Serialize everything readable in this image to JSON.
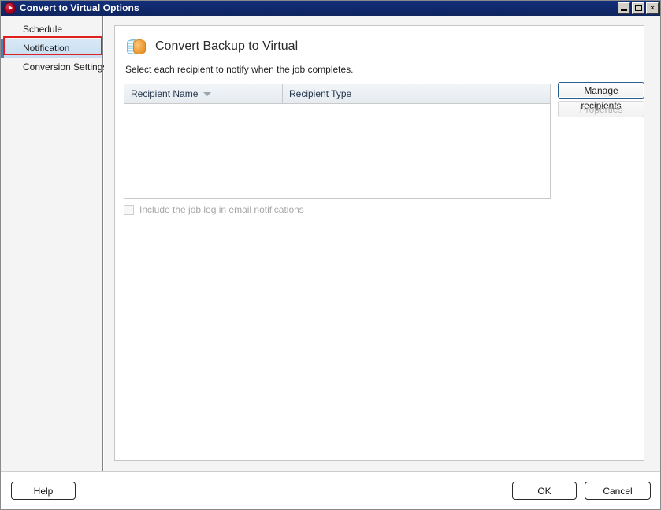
{
  "window": {
    "title": "Convert to Virtual Options",
    "app_icon": "record-circle-icon",
    "controls": {
      "minimize": "minimize-icon",
      "maximize": "maximize-icon",
      "close": "✕"
    }
  },
  "sidebar": {
    "items": [
      {
        "label": "Schedule",
        "selected": false
      },
      {
        "label": "Notification",
        "selected": true
      },
      {
        "label": "Conversion Settings",
        "selected": false
      }
    ]
  },
  "main": {
    "icon": "database-convert-icon",
    "title": "Convert Backup to Virtual",
    "subtitle": "Select each recipient to notify when the job completes.",
    "grid": {
      "columns": [
        "Recipient Name",
        "Recipient Type",
        ""
      ],
      "sort_column": "Recipient Name",
      "sort_direction": "descending",
      "rows": []
    },
    "checkbox": {
      "label": "Include the job log in email notifications",
      "checked": false,
      "enabled": false
    },
    "actions": {
      "manage_recipients": "Manage recipients",
      "properties": "Properties",
      "properties_enabled": false,
      "manage_focused": true
    }
  },
  "footer": {
    "help": "Help",
    "ok": "OK",
    "cancel": "Cancel"
  },
  "colors": {
    "titlebar": "#112a6e",
    "selection": "#cfe2f3",
    "highlight_box": "#e02020",
    "accent_blue": "#2c5d8f",
    "disabled_text": "#a6a6a6"
  }
}
